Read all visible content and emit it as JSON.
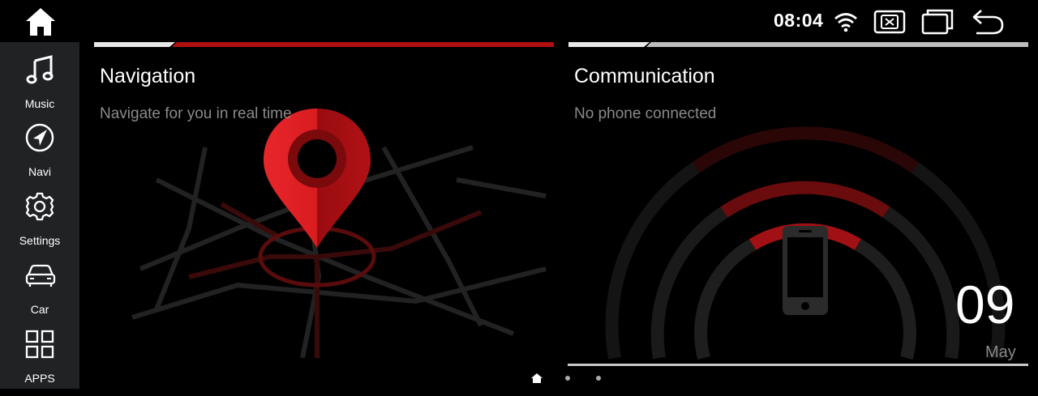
{
  "status_bar": {
    "time": "08:04",
    "icons": [
      "wifi-icon",
      "close-window-icon",
      "multi-window-icon",
      "back-icon"
    ]
  },
  "sidebar": {
    "home_icon": "home-icon",
    "items": [
      {
        "label": "Music",
        "icon": "music-note-icon"
      },
      {
        "label": "Navi",
        "icon": "compass-icon"
      },
      {
        "label": "Settings",
        "icon": "gear-icon"
      },
      {
        "label": "Car",
        "icon": "car-icon"
      },
      {
        "label": "APPS",
        "icon": "grid-icon"
      }
    ]
  },
  "cards": {
    "navigation": {
      "title": "Navigation",
      "subtitle": "Navigate for you in real time"
    },
    "communication": {
      "title": "Communication",
      "subtitle": "No phone connected"
    }
  },
  "date": {
    "day": "09",
    "month": "May"
  },
  "pager": {
    "icons": [
      "home-icon",
      "dot",
      "dot"
    ]
  },
  "colors": {
    "accent": "#b00f12",
    "sidebar": "#202224",
    "background": "#000000",
    "subtitle": "#8a8a8a"
  }
}
